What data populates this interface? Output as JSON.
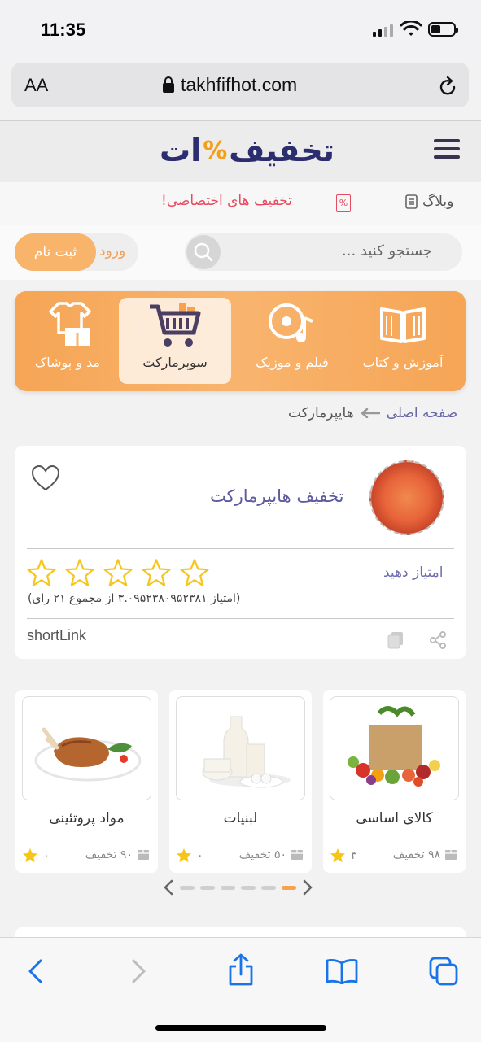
{
  "status": {
    "time": "11:35"
  },
  "browser": {
    "aa_label": "AA",
    "url": "takhfifhot.com"
  },
  "header": {
    "logo_text": "تخفیف",
    "logo_suffix": "ات"
  },
  "promo": {
    "text": "تخفیف های اختصاصی!",
    "blog_label": "وبلاگ"
  },
  "search": {
    "placeholder": "جستجو کنید ..."
  },
  "auth": {
    "signup_label": "ثبت نام",
    "login_label": "ورود"
  },
  "categories": [
    {
      "label": "آموزش و کتاب",
      "icon": "book-icon"
    },
    {
      "label": "فیلم و موزیک",
      "icon": "disc-music-icon"
    },
    {
      "label": "سوپرمارکت",
      "icon": "cart-icon",
      "active": true
    },
    {
      "label": "مد و پوشاک",
      "icon": "clothes-icon"
    }
  ],
  "breadcrumb": {
    "home": "صفحه اصلی",
    "current": "هایپرمارکت"
  },
  "store": {
    "title": "تخفیف هایپرمارکت",
    "rate_label": "امتیاز دهید",
    "stars": 5,
    "rating_info": "(امتیاز ۳.۰۹۵۲۳۸۰۹۵۲۳۸۱ از مجموع ۲۱ رای)",
    "short_link": "shortLink"
  },
  "products": [
    {
      "name": "کالای اساسی",
      "deals": "۹۸ تخفیف",
      "rating": "۳"
    },
    {
      "name": "لبنیات",
      "deals": "۵۰ تخفیف",
      "rating": "۰"
    },
    {
      "name": "مواد پروتئینی",
      "deals": "۹۰ تخفیف",
      "rating": "۰"
    }
  ],
  "carousel": {
    "pages": 6,
    "active_page": 6
  },
  "colors": {
    "accent": "#f7a34d",
    "brand_navy": "#2b2d6e",
    "promo_red": "#e84a5f",
    "link_purple": "#6766a8",
    "star": "#f5c518"
  }
}
